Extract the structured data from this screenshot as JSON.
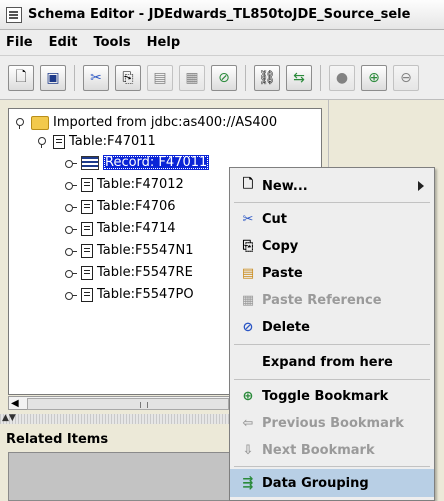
{
  "window": {
    "title": "Schema Editor - JDEdwards_TL850toJDE_Source_sele"
  },
  "menubar": {
    "items": [
      {
        "label": "File"
      },
      {
        "label": "Edit"
      },
      {
        "label": "Tools"
      },
      {
        "label": "Help"
      }
    ]
  },
  "toolbar": {
    "buttons": [
      {
        "icon": "new-document-icon",
        "glyph": "🗋",
        "enabled": true
      },
      {
        "icon": "save-icon",
        "glyph": "💾",
        "enabled": true
      },
      {
        "icon": "cut-icon",
        "glyph": "✂",
        "enabled": true
      },
      {
        "icon": "copy-icon",
        "glyph": "⎘",
        "enabled": true
      },
      {
        "icon": "paste-icon",
        "glyph": "📋",
        "enabled": false
      },
      {
        "icon": "paste-reference-icon",
        "glyph": "▣",
        "enabled": false
      },
      {
        "icon": "delete-icon",
        "glyph": "🗑",
        "enabled": true
      },
      {
        "icon": "link-icon",
        "glyph": "⛓",
        "enabled": true
      },
      {
        "icon": "relation-icon",
        "glyph": "⇆",
        "enabled": true
      },
      {
        "icon": "bookmark-icon",
        "glyph": "●",
        "enabled": false
      },
      {
        "icon": "zoom-in-icon",
        "glyph": "⊕",
        "enabled": true
      },
      {
        "icon": "zoom-out-icon",
        "glyph": "⊖",
        "enabled": false
      }
    ]
  },
  "tree": {
    "root": "Imported from jdbc:as400://AS400",
    "table_main": "Table:F47011",
    "record_selected": "Record: F47011",
    "tables": [
      "Table:F47012",
      "Table:F4706",
      "Table:F4714",
      "Table:F5547N1",
      "Table:F5547RE",
      "Table:F5547PO"
    ]
  },
  "related": {
    "header": "Related Items"
  },
  "context_menu": {
    "new": {
      "label": "New...",
      "icon": "new-document-icon"
    },
    "cut": {
      "label": "Cut",
      "icon": "cut-icon"
    },
    "copy": {
      "label": "Copy",
      "icon": "copy-icon"
    },
    "paste": {
      "label": "Paste",
      "icon": "paste-icon"
    },
    "paste_reference": {
      "label": "Paste Reference",
      "icon": "paste-reference-icon",
      "enabled": false
    },
    "delete": {
      "label": "Delete",
      "icon": "delete-icon"
    },
    "expand": {
      "label": "Expand from here"
    },
    "toggle_bookmark": {
      "label": "Toggle Bookmark",
      "icon": "plus-circle-icon"
    },
    "previous_bookmark": {
      "label": "Previous Bookmark",
      "icon": "arrow-left-icon",
      "enabled": false
    },
    "next_bookmark": {
      "label": "Next Bookmark",
      "icon": "down-arrow-icon",
      "enabled": false
    },
    "data_grouping": {
      "label": "Data Grouping",
      "icon": "data-grouping-icon"
    }
  }
}
